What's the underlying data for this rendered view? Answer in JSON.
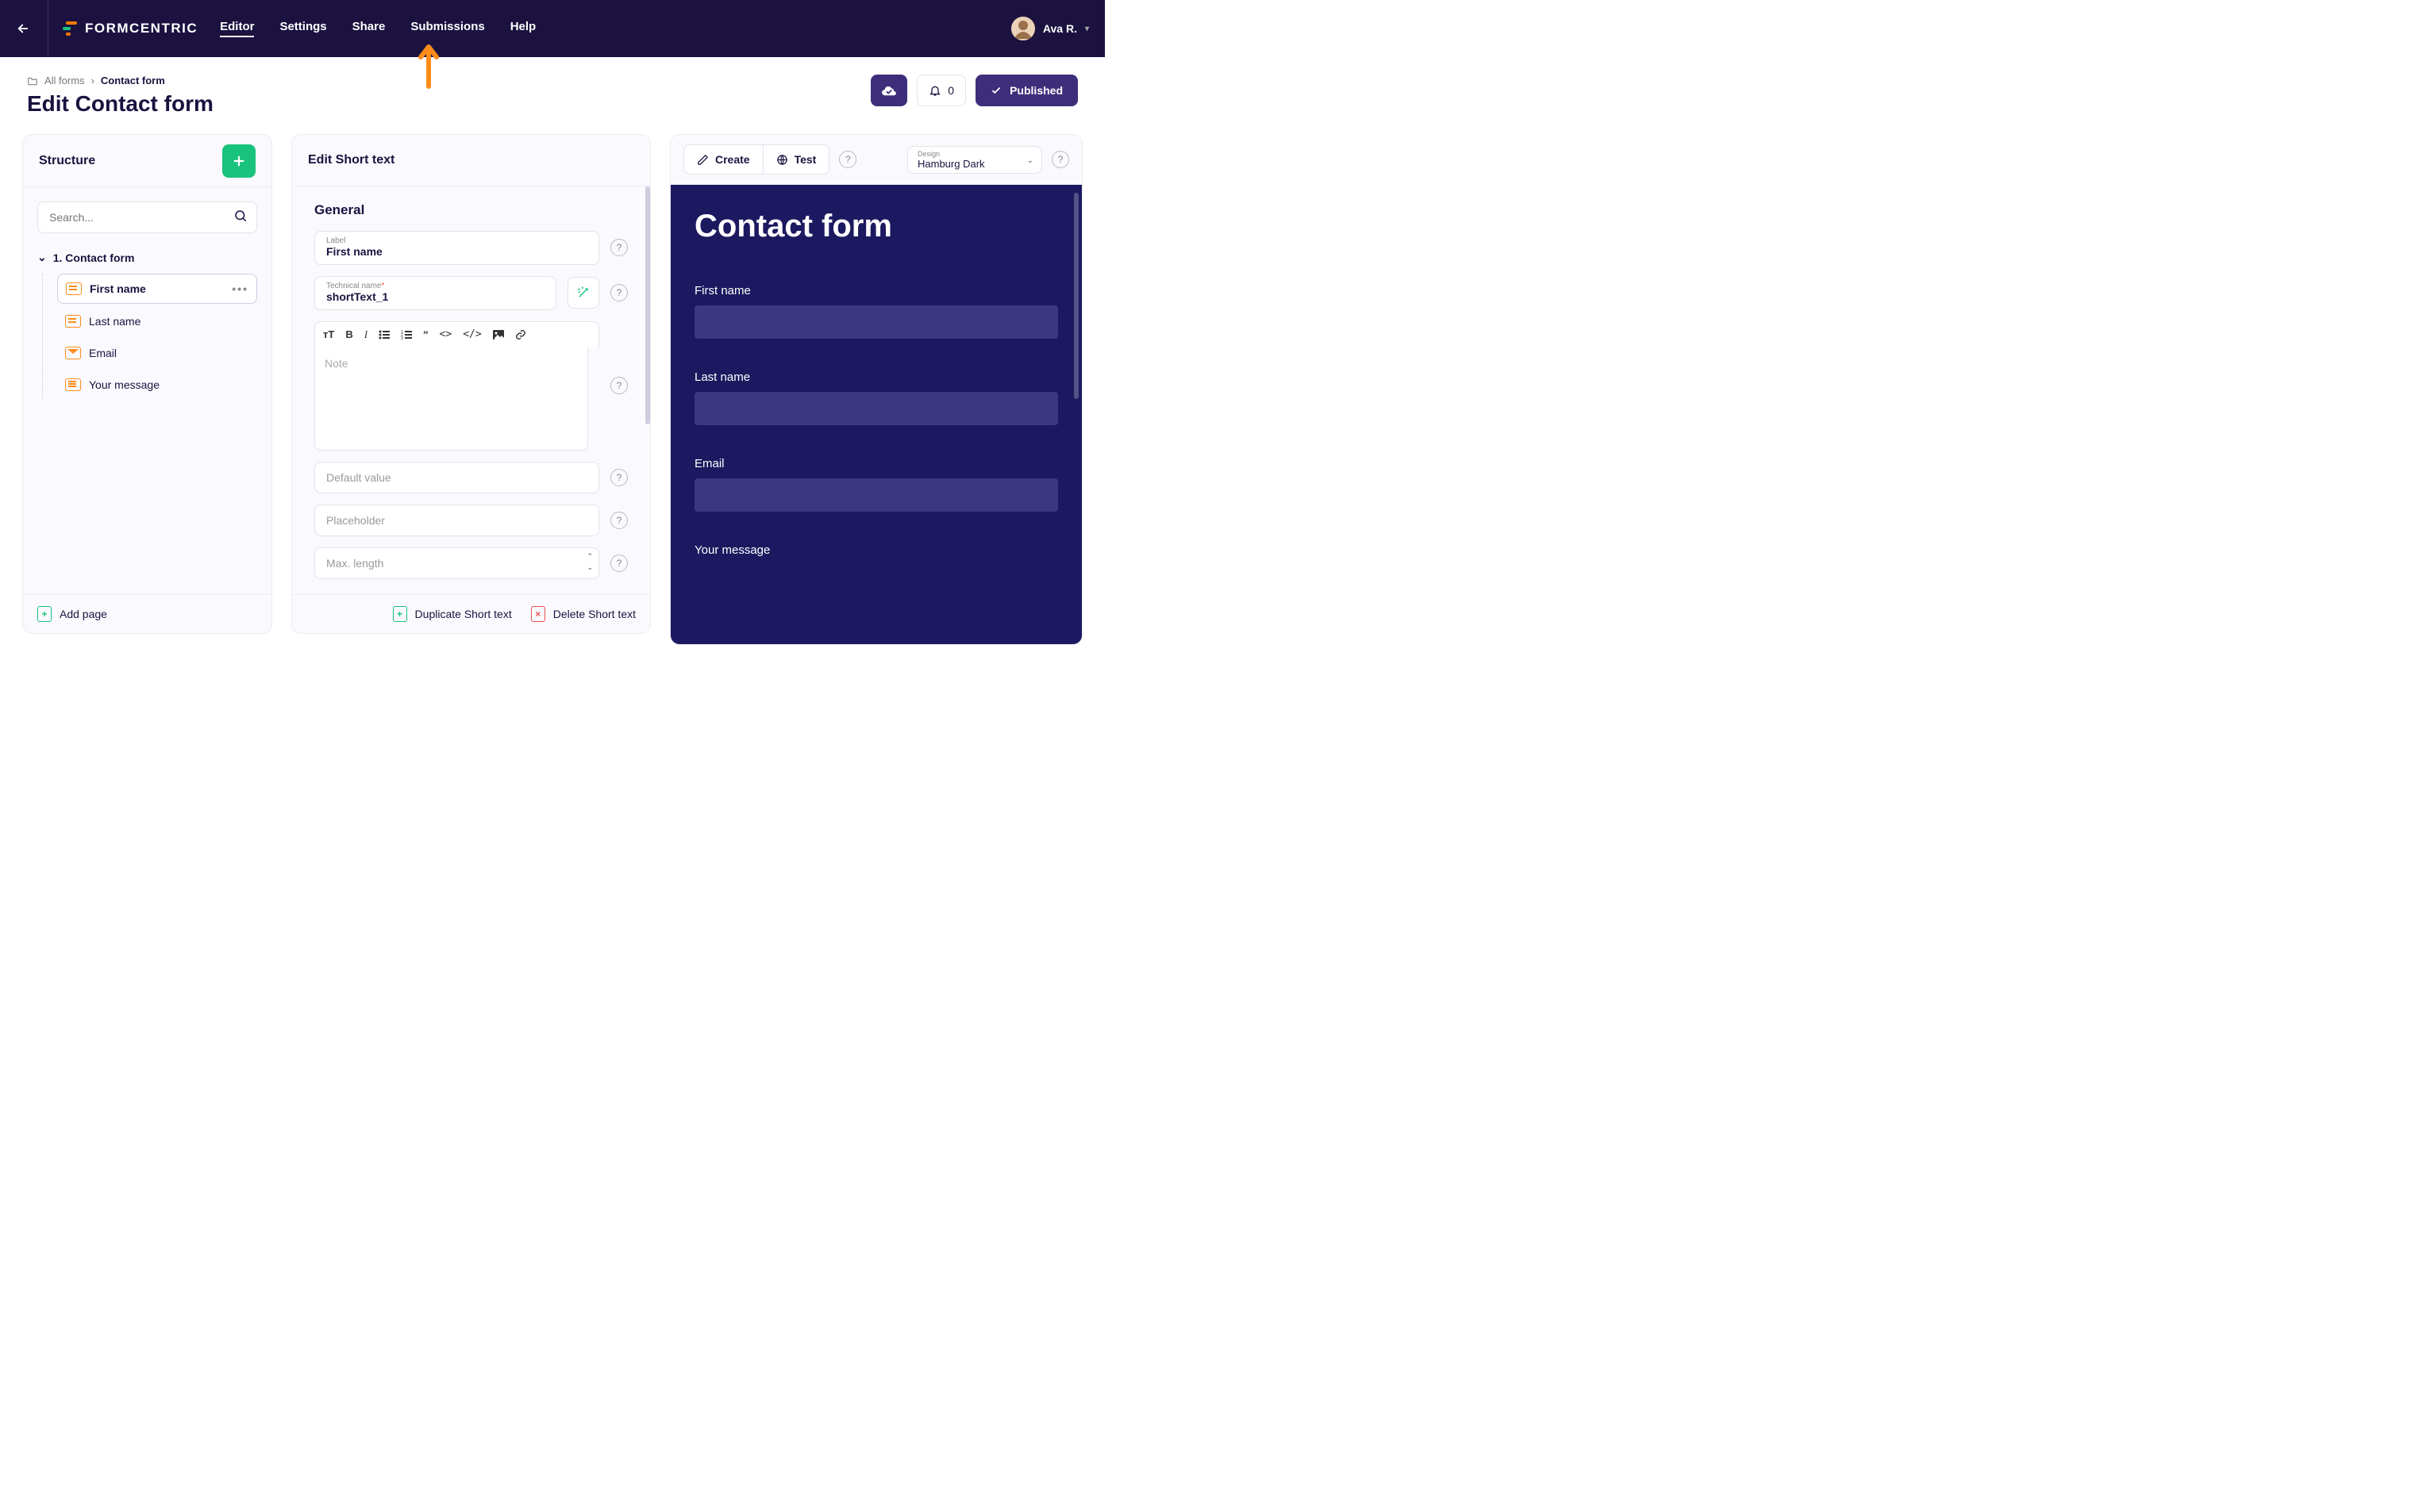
{
  "nav": {
    "logo_text": "FORMCENTRIC",
    "items": [
      "Editor",
      "Settings",
      "Share",
      "Submissions",
      "Help"
    ],
    "active_index": 0,
    "user_name": "Ava R."
  },
  "breadcrumb": {
    "root": "All forms",
    "current": "Contact form"
  },
  "page_title": "Edit Contact form",
  "header": {
    "notification_count": "0",
    "publish_label": "Published"
  },
  "structure": {
    "title": "Structure",
    "search_placeholder": "Search...",
    "root_label": "1. Contact form",
    "items": [
      {
        "label": "First name",
        "type": "text",
        "selected": true
      },
      {
        "label": "Last name",
        "type": "text",
        "selected": false
      },
      {
        "label": "Email",
        "type": "mail",
        "selected": false
      },
      {
        "label": "Your message",
        "type": "msg",
        "selected": false
      }
    ],
    "add_page_label": "Add page"
  },
  "edit": {
    "title": "Edit Short text",
    "section": "General",
    "label_field": {
      "label": "Label",
      "value": "First name"
    },
    "technical_field": {
      "label": "Technical name",
      "value": "shortText_1",
      "required": true
    },
    "note_placeholder": "Note",
    "default_placeholder": "Default value",
    "placeholder_placeholder": "Placeholder",
    "maxlength_placeholder": "Max. length",
    "duplicate_label": "Duplicate Short text",
    "delete_label": "Delete Short text"
  },
  "preview": {
    "create_label": "Create",
    "test_label": "Test",
    "design_label": "Design",
    "design_value": "Hamburg Dark",
    "form_title": "Contact form",
    "fields": [
      "First name",
      "Last name",
      "Email",
      "Your message"
    ]
  }
}
